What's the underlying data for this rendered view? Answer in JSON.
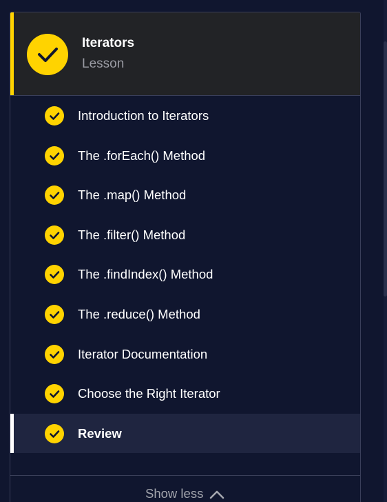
{
  "lesson": {
    "title": "Iterators",
    "type": "Lesson",
    "status_icon": "check-circle-icon"
  },
  "items": [
    {
      "label": "Introduction to Iterators",
      "completed": true,
      "active": false
    },
    {
      "label": "The .forEach() Method",
      "completed": true,
      "active": false
    },
    {
      "label": "The .map() Method",
      "completed": true,
      "active": false
    },
    {
      "label": "The .filter() Method",
      "completed": true,
      "active": false
    },
    {
      "label": "The .findIndex() Method",
      "completed": true,
      "active": false
    },
    {
      "label": "The .reduce() Method",
      "completed": true,
      "active": false
    },
    {
      "label": "Iterator Documentation",
      "completed": true,
      "active": false
    },
    {
      "label": "Choose the Right Iterator",
      "completed": true,
      "active": false
    },
    {
      "label": "Review",
      "completed": true,
      "active": true
    }
  ],
  "footer": {
    "toggle_label": "Show less",
    "toggle_icon": "chevron-up-icon"
  },
  "colors": {
    "background": "#10162f",
    "header_bg": "#222326",
    "accent_yellow": "#ffd300",
    "text": "#ffffff",
    "muted_text": "#9a9ba3"
  }
}
